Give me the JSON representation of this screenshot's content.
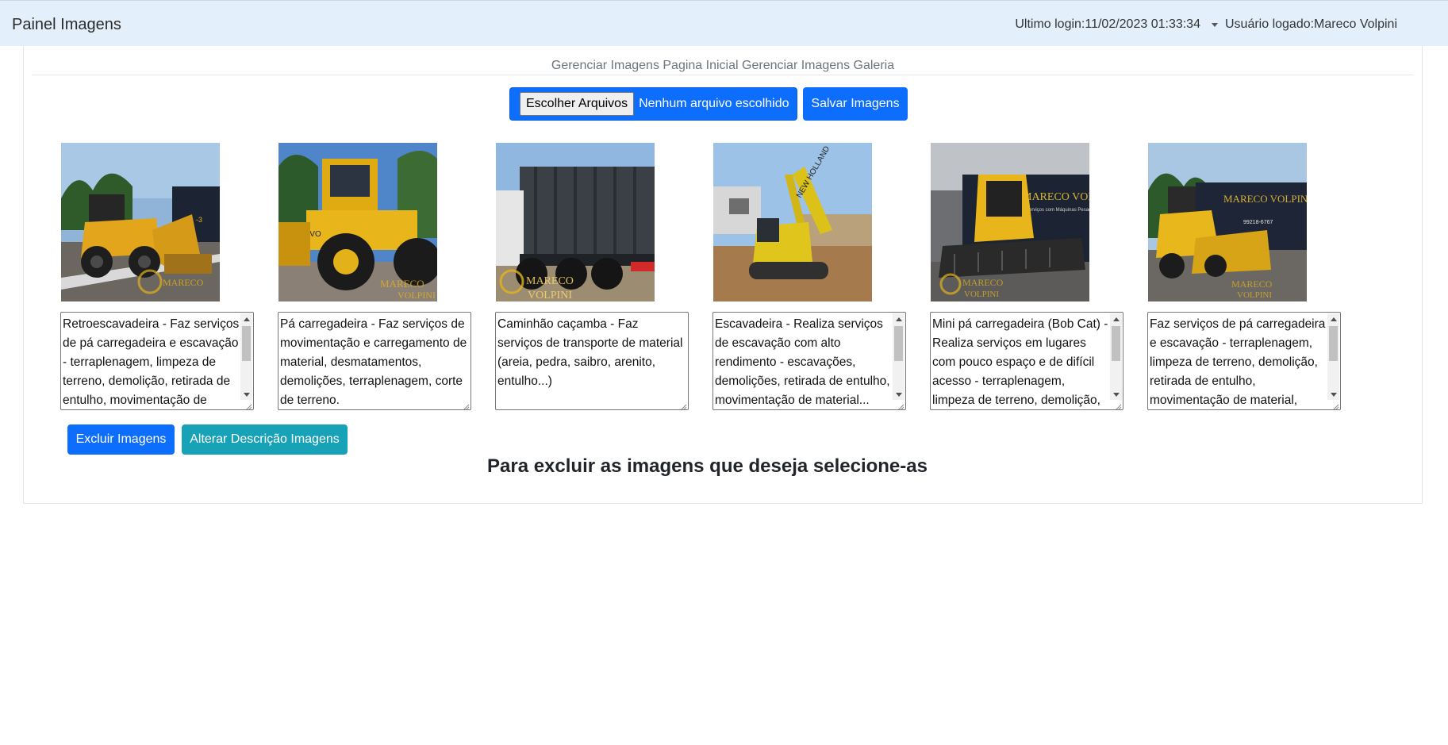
{
  "navbar": {
    "brand": "Painel Imagens",
    "last_login": "Ultimo login:11/02/2023 01:33:34",
    "logged_user": "Usuário logado:Mareco Volpini"
  },
  "header": {
    "link_home": "Gerenciar Imagens Pagina Inicial",
    "link_gallery": "Gerenciar Imagens Galeria"
  },
  "upload": {
    "choose_label": "Escolher Arquivos",
    "status": "Nenhum arquivo escolhido",
    "save_label": "Salvar Imagens"
  },
  "gallery": [
    {
      "image": "backhoe-loader-photo",
      "description": "Retroescavadeira - Faz serviços de pá carregadeira e escavação - terraplenagem, limpeza de terreno, demolição, retirada de entulho, movimentação de material..."
    },
    {
      "image": "wheel-loader-photo",
      "description": "Pá carregadeira - Faz serviços de movimentação e carregamento de material, desmatamentos, demolições, terraplenagem, corte de terreno."
    },
    {
      "image": "dump-truck-photo",
      "description": "Caminhão caçamba - Faz serviços de transporte de material (areia, pedra, saibro, arenito, entulho...)"
    },
    {
      "image": "excavator-photo",
      "description": "Escavadeira - Realiza serviços de escavação com alto rendimento - escavações, demolições, retirada de entulho, movimentação de material..."
    },
    {
      "image": "skid-steer-photo",
      "description": "Mini pá carregadeira (Bob Cat) - Realiza serviços em lugares com pouco espaço e de difícil acesso - terraplenagem, limpeza de terreno, demolição, retirada de entulho..."
    },
    {
      "image": "backhoe-front-photo",
      "description": "Faz serviços de pá carregadeira e escavação - terraplenagem, limpeza de terreno, demolição, retirada de entulho, movimentação de material, corte de terreno..."
    }
  ],
  "actions": {
    "delete_label": "Excluir Imagens",
    "alter_label": "Alterar Descrição Imagens"
  },
  "note": "Para excluir as imagens que deseja selecione-as",
  "colors": {
    "navbar_bg": "#e3f0fb",
    "primary": "#0d6efd",
    "info": "#17a2b8",
    "machine_yellow": "#e3b21b"
  }
}
